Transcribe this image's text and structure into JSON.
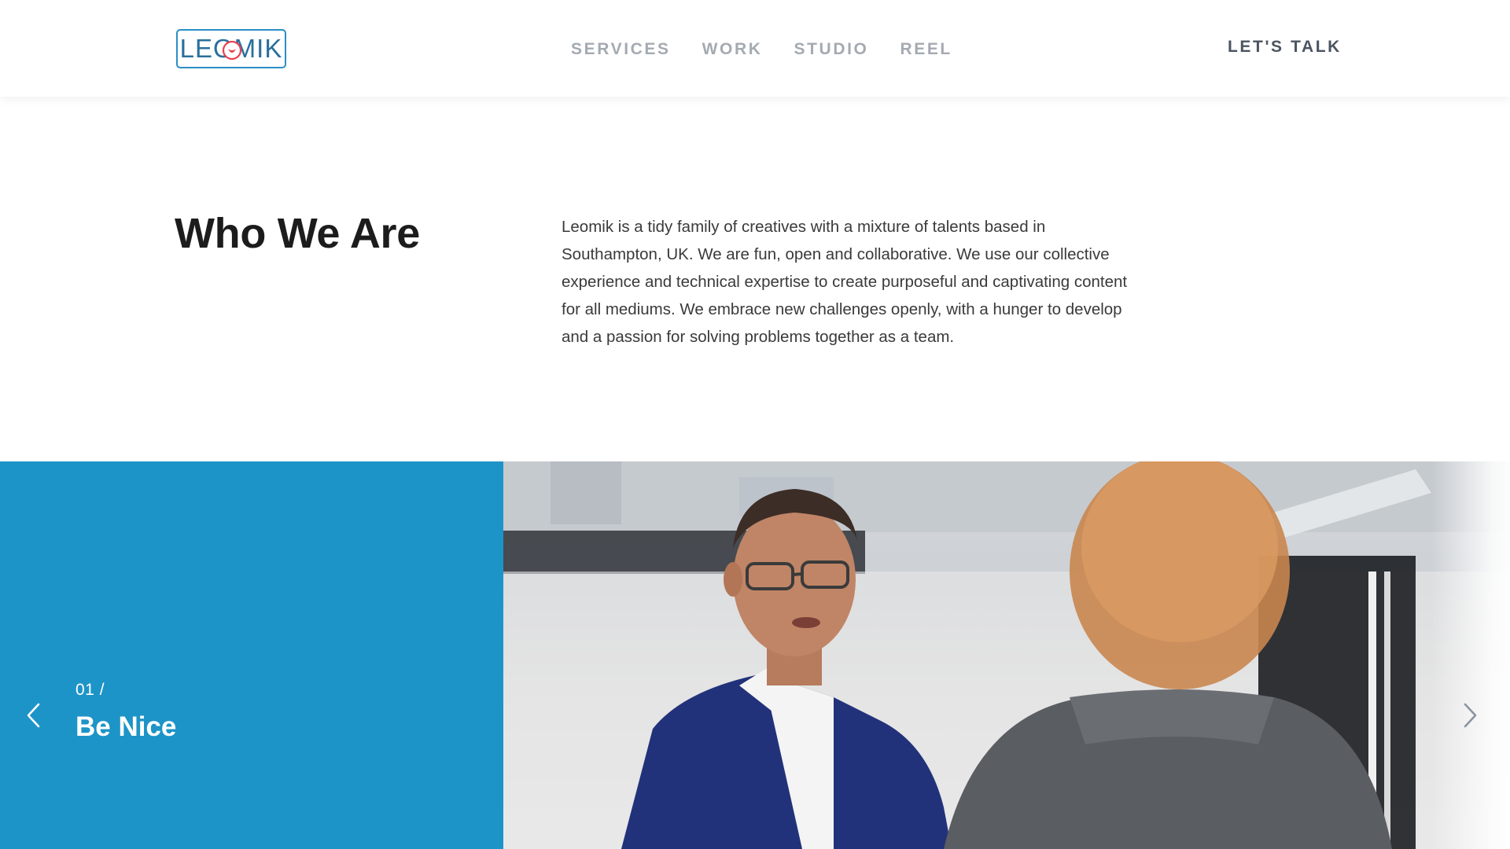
{
  "header": {
    "logo_text": "LEOMIK",
    "nav": [
      {
        "label": "SERVICES"
      },
      {
        "label": "WORK"
      },
      {
        "label": "STUDIO"
      },
      {
        "label": "REEL"
      }
    ],
    "cta_label": "LET'S TALK"
  },
  "intro": {
    "title": "Who We Are",
    "body": "Leomik is a tidy family of creatives with a mixture of talents based in Southampton, UK. We are fun, open and collaborative. We use our collective experience and technical expertise to create purposeful and captivating content for all mediums. We embrace new challenges openly, with a hunger to develop and a passion for solving problems together as a team."
  },
  "slider": {
    "number": "01 /",
    "title": "Be Nice",
    "prev_icon": "chevron-left-icon",
    "next_icon": "chevron-right-icon"
  },
  "colors": {
    "brand_blue": "#1d94c8",
    "logo_heart": "#e8414f",
    "nav_text": "#a4aab1",
    "cta_text": "#4b5560"
  }
}
